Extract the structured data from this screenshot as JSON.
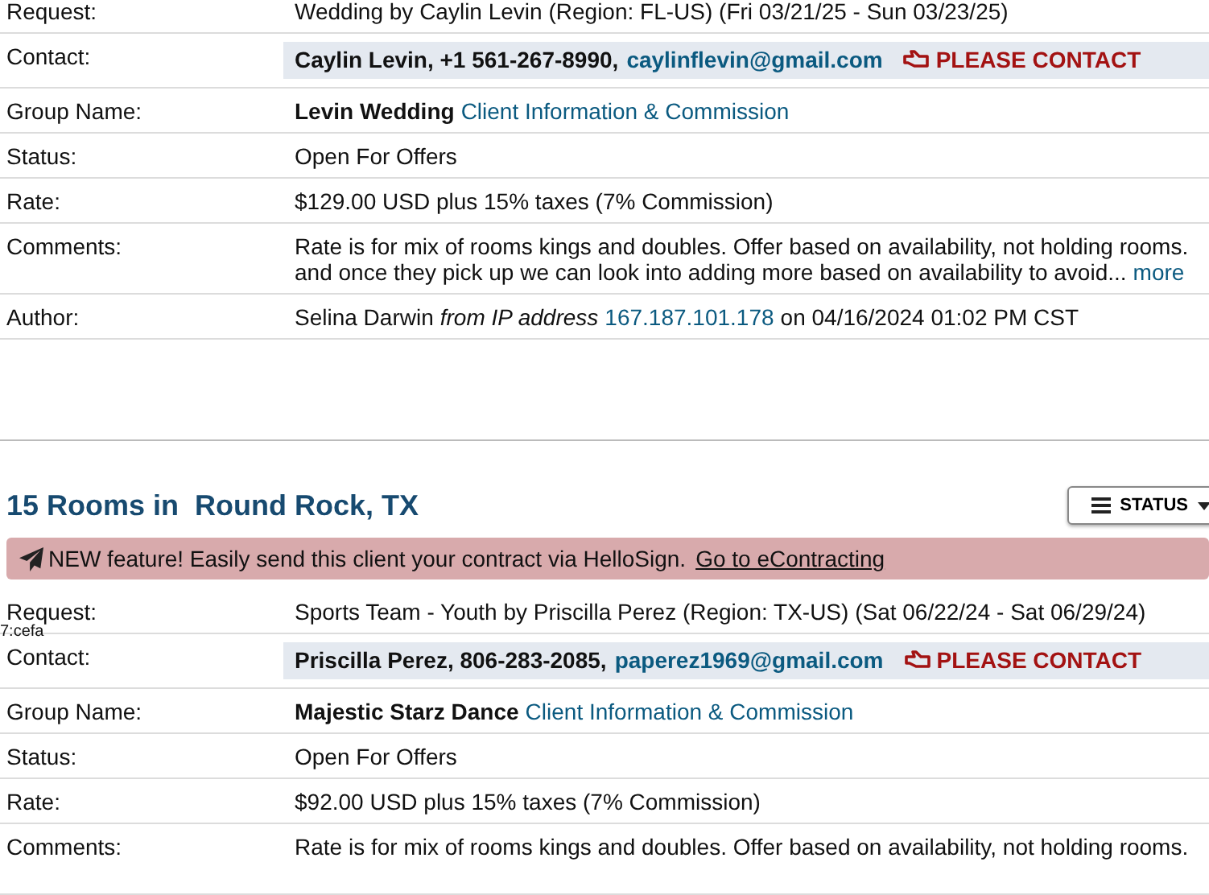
{
  "records": [
    {
      "fields": [
        {
          "kind": "text",
          "label": "Request:",
          "value": "Wedding by Caylin Levin (Region: FL-US) (Fri 03/21/25 - Sun 03/23/25)"
        },
        {
          "kind": "contact",
          "label": "Contact:",
          "name_phone": "Caylin Levin, +1 561-267-8990,",
          "email": "caylinflevin@gmail.com",
          "action": "PLEASE CONTACT"
        },
        {
          "kind": "group",
          "label": "Group Name:",
          "name": "Levin Wedding",
          "link": "Client Information & Commission"
        },
        {
          "kind": "text",
          "label": "Status:",
          "value": "Open For Offers"
        },
        {
          "kind": "text",
          "label": "Rate:",
          "value": "$129.00 USD plus 15% taxes (7% Commission)"
        },
        {
          "kind": "comments",
          "label": "Comments:",
          "lines": [
            "Rate is for mix of rooms kings and doubles. Offer based on availability, not holding rooms.",
            "and once they pick up we can look into adding more based on availability to avoid..."
          ],
          "more": "more"
        },
        {
          "kind": "author",
          "label": "Author:",
          "name": "Selina Darwin",
          "via": "from IP address",
          "ip": "167.187.101.178",
          "when": "on 04/16/2024 01:02 PM CST"
        }
      ]
    },
    {
      "heading": "15 Rooms in  Round Rock, TX",
      "status_button": "STATUS",
      "banner": {
        "text": "NEW feature! Easily send this client your contract via HelloSign.",
        "link": "Go to eContracting"
      },
      "stray_text": "7:cefa",
      "fields": [
        {
          "kind": "text",
          "label": "Request:",
          "value": "Sports Team - Youth by Priscilla Perez (Region: TX-US) (Sat 06/22/24 - Sat 06/29/24)"
        },
        {
          "kind": "contact",
          "label": "Contact:",
          "name_phone": "Priscilla Perez, 806-283-2085,",
          "email": "paperez1969@gmail.com",
          "action": "PLEASE CONTACT"
        },
        {
          "kind": "group",
          "label": "Group Name:",
          "name": "Majestic Starz Dance",
          "link": "Client Information & Commission"
        },
        {
          "kind": "text",
          "label": "Status:",
          "value": "Open For Offers"
        },
        {
          "kind": "text",
          "label": "Rate:",
          "value": "$92.00 USD plus 15% taxes (7% Commission)"
        },
        {
          "kind": "comments",
          "label": "Comments:",
          "lines": [
            "Rate is for mix of rooms kings and doubles. Offer based on availability, not holding rooms."
          ]
        }
      ]
    }
  ]
}
